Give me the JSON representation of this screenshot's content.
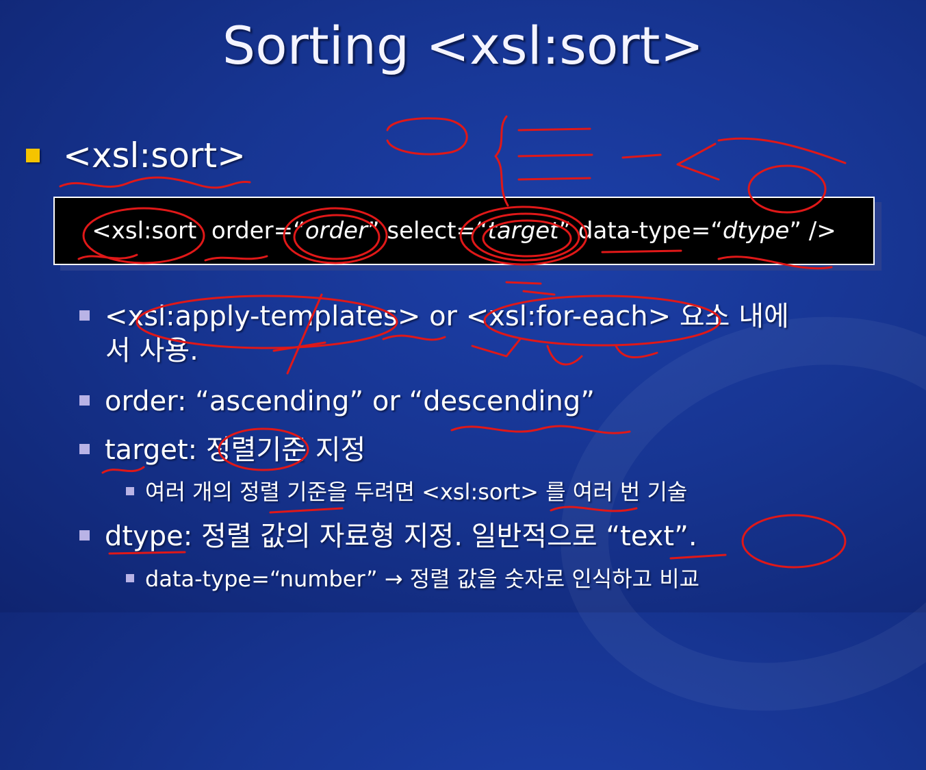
{
  "slide": {
    "title": "Sorting <xsl:sort>",
    "heading": "<xsl:sort>",
    "code": {
      "p1": "<xsl:sort  order=“",
      "order_var": "order",
      "p2": "” select=“",
      "target_var": "target",
      "p3": "” data-type=“",
      "dtype_var": "dtype",
      "p4": "” />"
    },
    "bullets": [
      {
        "line1": "<xsl:apply-templates> or <xsl:for-each> 요소 내에",
        "line2": "서 사용."
      },
      {
        "text": "order: “ascending” or “descending”"
      },
      {
        "text": "target: 정렬기준 지정"
      },
      {
        "text": "여러 개의 정렬 기준을 두려면 <xsl:sort> 를 여러 번 기술"
      },
      {
        "text": "dtype: 정렬 값의 자료형 지정. 일반적으로 “text”."
      },
      {
        "text": "data-type=“number” → 정렬 값을 숫자로 인식하고 비교"
      }
    ]
  },
  "colors": {
    "background": "#173592",
    "heading_bullet": "#f5c400",
    "sub_bullet": "#b9b3e6",
    "ink": "#e01818"
  }
}
